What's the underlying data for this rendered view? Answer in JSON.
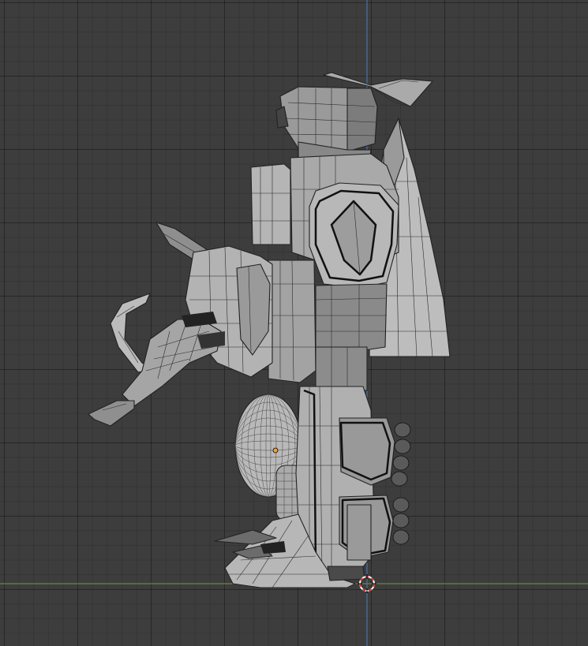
{
  "viewport": {
    "view": "side-orthographic",
    "grid": true,
    "colors": {
      "background": "#3d3d3d",
      "grid_line": "#333333",
      "x_axis": "#6a8a2e",
      "z_axis": "#4a6e9e",
      "mesh_light": "#c8c8c8",
      "mesh_mid": "#a6a6a6",
      "mesh_dark": "#6f6f6f",
      "wire": "#222222",
      "cursor_red": "#d23a2f",
      "origin_orange": "#f0a030"
    },
    "icons": [
      "3d-cursor-icon",
      "object-origin-icon"
    ]
  }
}
